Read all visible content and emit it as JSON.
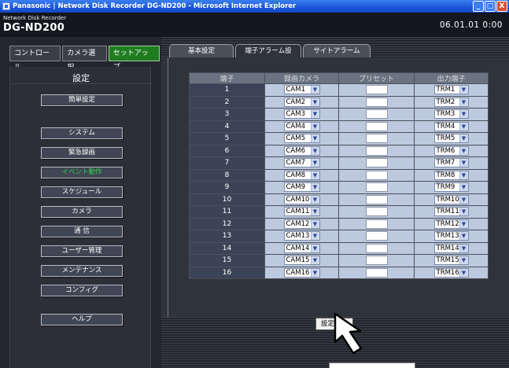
{
  "window": {
    "title": "Panasonic | Network Disk Recorder DG-ND200 - Microsoft Internet Explorer",
    "buttons": [
      "_",
      "□",
      "X"
    ]
  },
  "header": {
    "subtitle": "Network Disk Recorder",
    "model": "DG-ND200",
    "datetime": "06.01.01  0:00"
  },
  "mode_tabs": [
    {
      "label": "コントロール"
    },
    {
      "label": "カメラ選択"
    },
    {
      "label": "セットアップ"
    }
  ],
  "sidebar": {
    "title": "設定",
    "items": [
      {
        "label": "簡単設定"
      },
      {
        "label": "システム"
      },
      {
        "label": "緊急録画"
      },
      {
        "label": "イベント動作"
      },
      {
        "label": "スケジュール"
      },
      {
        "label": "カメラ"
      },
      {
        "label": "通 信"
      },
      {
        "label": "ユーザー管理"
      },
      {
        "label": "メンテナンス"
      },
      {
        "label": "コンフィグ"
      },
      {
        "label": "ヘルプ"
      }
    ]
  },
  "tabs": [
    {
      "label": "基本設定"
    },
    {
      "label": "端子アラーム設定"
    },
    {
      "label": "サイトアラーム設定"
    }
  ],
  "table": {
    "headers": [
      "端子",
      "録画カメラ",
      "プリセット",
      "出力端子"
    ],
    "rows": [
      {
        "terminal": "1",
        "camera": "CAM1",
        "output": "TRM1"
      },
      {
        "terminal": "2",
        "camera": "CAM2",
        "output": "TRM2"
      },
      {
        "terminal": "3",
        "camera": "CAM3",
        "output": "TRM3"
      },
      {
        "terminal": "4",
        "camera": "CAM4",
        "output": "TRM4"
      },
      {
        "terminal": "5",
        "camera": "CAM5",
        "output": "TRM5"
      },
      {
        "terminal": "6",
        "camera": "CAM6",
        "output": "TRM6"
      },
      {
        "terminal": "7",
        "camera": "CAM7",
        "output": "TRM7"
      },
      {
        "terminal": "8",
        "camera": "CAM8",
        "output": "TRM8"
      },
      {
        "terminal": "9",
        "camera": "CAM9",
        "output": "TRM9"
      },
      {
        "terminal": "10",
        "camera": "CAM10",
        "output": "TRM10"
      },
      {
        "terminal": "11",
        "camera": "CAM11",
        "output": "TRM11"
      },
      {
        "terminal": "12",
        "camera": "CAM12",
        "output": "TRM12"
      },
      {
        "terminal": "13",
        "camera": "CAM13",
        "output": "TRM13"
      },
      {
        "terminal": "14",
        "camera": "CAM14",
        "output": "TRM14"
      },
      {
        "terminal": "15",
        "camera": "CAM15",
        "output": "TRM15"
      },
      {
        "terminal": "16",
        "camera": "CAM16",
        "output": "TRM16"
      }
    ]
  },
  "save_button": {
    "label": "設定保存"
  },
  "dropdown_arrow": "▼",
  "colors": {
    "active_green": "#1f7d1f",
    "active_text_green": "#33d34d",
    "title_blue": "#1a55d8"
  }
}
